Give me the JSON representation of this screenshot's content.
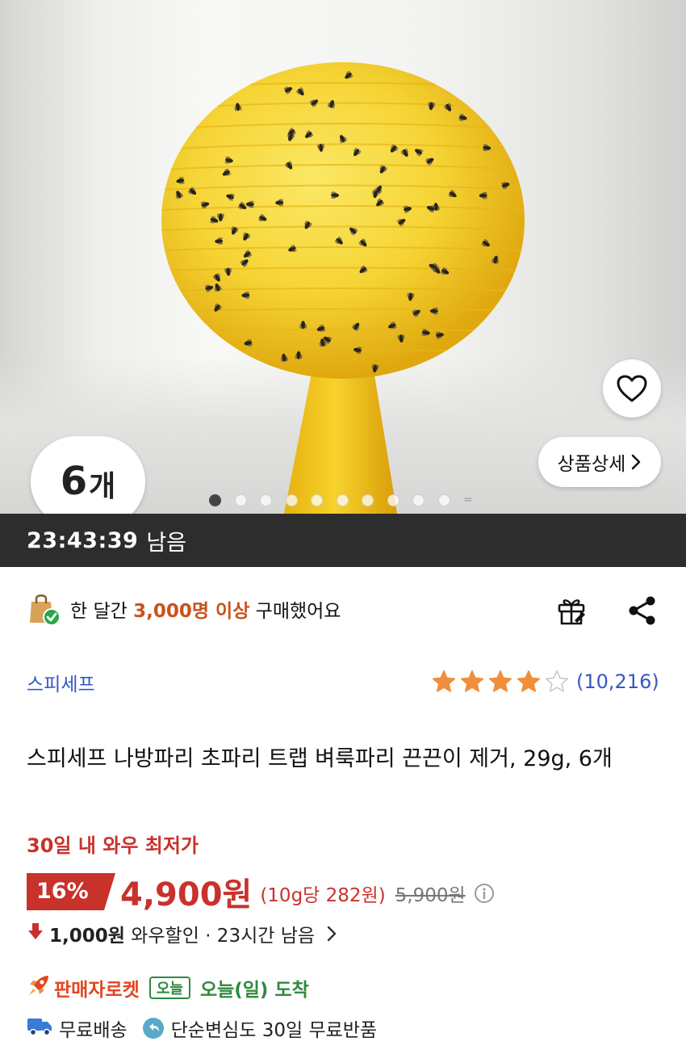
{
  "hero": {
    "quantity_number": "6",
    "quantity_unit": "개",
    "detail_label": "상품상세",
    "total_images": 11,
    "active_image": 1,
    "more_indicator": "="
  },
  "timer": {
    "time": "23:43:39",
    "suffix": "남음"
  },
  "purchase": {
    "prefix": "한 달간 ",
    "highlight": "3,000명 이상",
    "suffix": " 구매했어요"
  },
  "brand": "스피세프",
  "rating": {
    "stars": 4,
    "max": 5,
    "count": "(10,216)"
  },
  "product": {
    "title": "스피세프 나방파리 초파리 트랩 벼룩파리 끈끈이 제거, 29g, 6개"
  },
  "pricing": {
    "lowest_label": "30일 내 와우 최저가",
    "discount": "16%",
    "price": "4,900원",
    "unit_price": "(10g당 282원)",
    "original_price": "5,900원",
    "wow_amount": "1,000원",
    "wow_text": " 와우할인 · 23시간 남음"
  },
  "delivery": {
    "seller_rocket": "판매자로켓",
    "today_badge": "오늘",
    "arrival": "오늘(일) 도착",
    "free_shipping": "무료배송",
    "free_return": "단순변심도 30일 무료반품"
  },
  "colors": {
    "accent_red": "#c8322b",
    "link_blue": "#3557c8",
    "star_orange": "#ef8e3b",
    "green": "#2f8a3c",
    "timer_bg": "#2d2d2d"
  }
}
